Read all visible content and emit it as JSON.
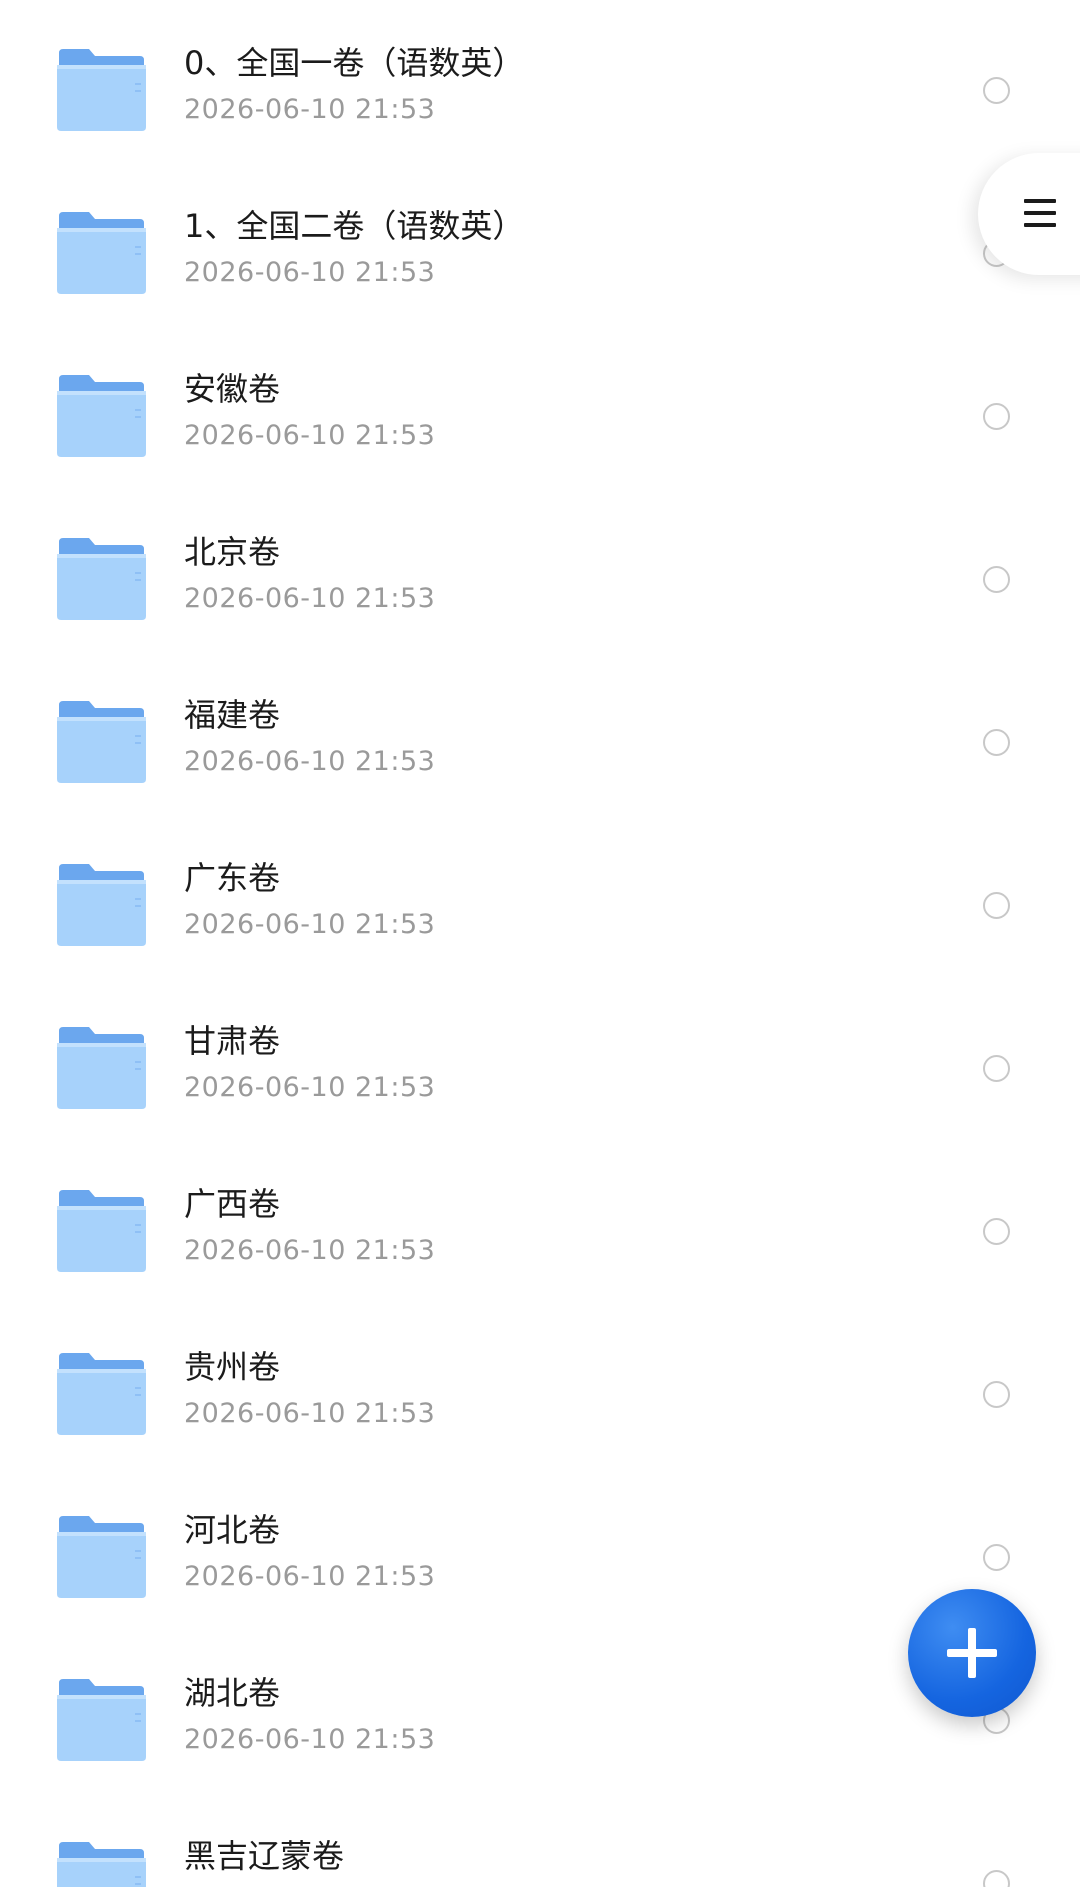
{
  "colors": {
    "folder_back": "#6ba7ee",
    "folder_front": "#a7d2fb",
    "fab": "#1565e0",
    "date_text": "#9a9a9a",
    "name_text": "#1b1b1b"
  },
  "icons": {
    "folder": "folder-icon",
    "menu": "menu-icon",
    "add": "plus-icon",
    "select": "radio-icon"
  },
  "files": [
    {
      "name": "0、全国一卷（语数英）",
      "date": "2026-06-10 21:53"
    },
    {
      "name": "1、全国二卷（语数英）",
      "date": "2026-06-10 21:53"
    },
    {
      "name": "安徽卷",
      "date": "2026-06-10 21:53"
    },
    {
      "name": "北京卷",
      "date": "2026-06-10 21:53"
    },
    {
      "name": "福建卷",
      "date": "2026-06-10 21:53"
    },
    {
      "name": "广东卷",
      "date": "2026-06-10 21:53"
    },
    {
      "name": "甘肃卷",
      "date": "2026-06-10 21:53"
    },
    {
      "name": "广西卷",
      "date": "2026-06-10 21:53"
    },
    {
      "name": "贵州卷",
      "date": "2026-06-10 21:53"
    },
    {
      "name": "河北卷",
      "date": "2026-06-10 21:53"
    },
    {
      "name": "湖北卷",
      "date": "2026-06-10 21:53"
    },
    {
      "name": "黑吉辽蒙卷",
      "date": ""
    }
  ]
}
